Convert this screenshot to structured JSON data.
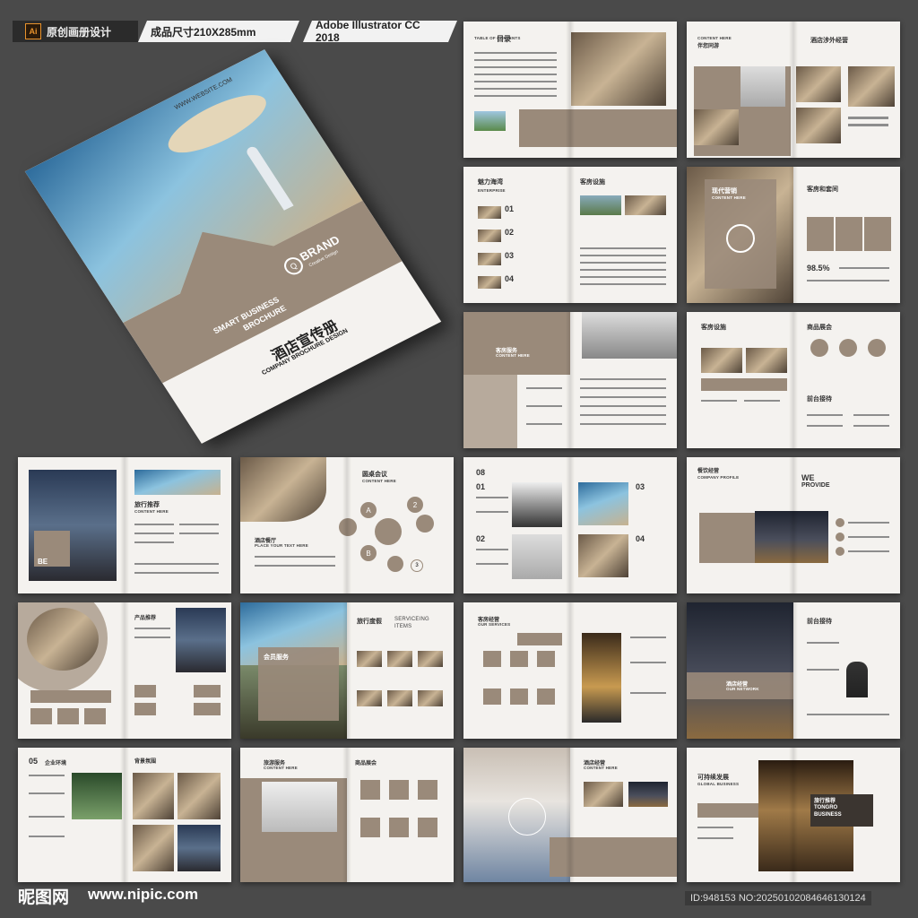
{
  "topbar": {
    "ai_label": "Ai",
    "original_design": "原创画册设计",
    "size": "成品尺寸210X285mm",
    "software": "Adobe Illustrator CC 2018"
  },
  "cover": {
    "website": "WWW.WEBSITE.COM",
    "brand": "BRAND",
    "brand_sub": "Creative Design",
    "brand_mark": "Q",
    "smart1": "SMART BUSINESS",
    "smart2": "BROCHURE",
    "title_cn": "酒店宣传册",
    "title_en": "COMPANY BROCHURE DESIGN"
  },
  "pages": {
    "p1_toc_en": "TABLE OF CONTENTS",
    "p1_toc_cn": "目录",
    "p2_cn": "伴您同游",
    "p2_en": "CONTENT HERE",
    "p2_right_cn": "酒店涉外经营",
    "p3_cn": "魅力海湾",
    "p3_en": "ENTERPRISE",
    "p3_right_cn": "客房设施",
    "p3_nums": [
      "01",
      "02",
      "03",
      "04"
    ],
    "p4_cn": "现代营销",
    "p4_en": "CONTENT HERE",
    "p4_right_cn": "客房和套间",
    "p4_pct": "98.5%",
    "p5_cn": "客房服务",
    "p5_en": "CONTENT HERE",
    "p6_cn": "客房设施",
    "p6_right_cn": "商品展会",
    "p6_right2_cn": "前台接待",
    "p7_cn": "旅行推荐",
    "p7_en": "CONTENT HERE",
    "p7_be": "BE",
    "p8_cn": "圆桌会议",
    "p8_en": "CONTENT HERE",
    "p8_left_cn": "酒店餐厅",
    "p8_left_en": "PLACE YOUR TEXT HERE",
    "p8_letters": [
      "A",
      "B",
      "1",
      "2",
      "3"
    ],
    "p9_num": "08",
    "p9_nums": [
      "01",
      "02",
      "03",
      "04"
    ],
    "p10_cn": "餐饮经营",
    "p10_en": "COMPANY PROFILE",
    "p10_we": "WE",
    "p10_provide": "PROVIDE",
    "p11_cn": "产品推荐",
    "p12_cn": "旅行度假",
    "p12_en1": "SERVICEING",
    "p12_en2": "ITEMS",
    "p12_left_cn": "会员服务",
    "p13_cn": "客房经营",
    "p13_en": "OUR SERVICES",
    "p14_cn": "酒店经营",
    "p14_en": "OUR NETWORK",
    "p14_right_cn": "前台接待",
    "p15_num": "05",
    "p15_cn": "企业环境",
    "p15_right_cn": "背景氛围",
    "p16_cn": "旅游服务",
    "p16_en": "CONTENT HERE",
    "p16_right_cn": "商品展会",
    "p17_cn": "酒店经营",
    "p17_en": "CONTENT HERE",
    "p18_cn": "可持续发展",
    "p18_en": "GLOBAL BUSINESS",
    "p18_right_cn": "旅行推荐",
    "p18_right_en1": "TONGRO",
    "p18_right_en2": "BUSINESS"
  },
  "footer": {
    "logo": "昵图网",
    "url": "www.nipic.com",
    "id": "ID:948153 NO:20250102084646130124"
  }
}
